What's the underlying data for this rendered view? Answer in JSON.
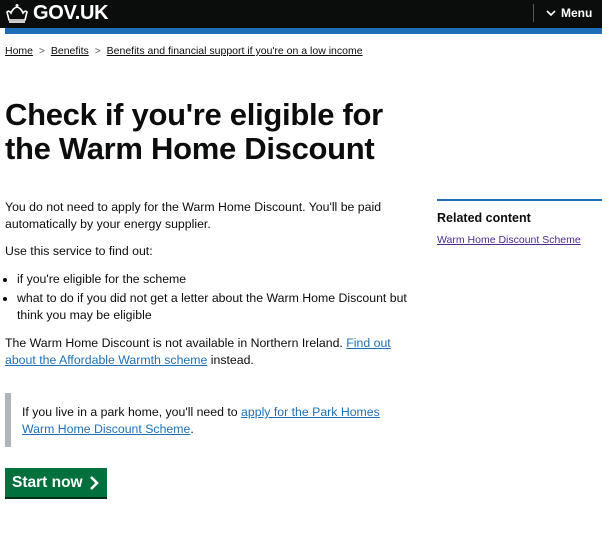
{
  "header": {
    "logo_text": "GOV.UK",
    "menu_label": "Menu"
  },
  "colors": {
    "header_bg": "#0b0c0c",
    "brand_blue": "#1d70b8",
    "start_button": "#00703c",
    "visited_link": "#4c2c92"
  },
  "breadcrumb": [
    {
      "label": "Home"
    },
    {
      "label": "Benefits"
    },
    {
      "label": "Benefits and financial support if you're on a low income"
    }
  ],
  "page_title": "Check if you're eligible for the Warm Home Discount",
  "intro": "You do not need to apply for the Warm Home Discount. You'll be paid automatically by your energy supplier.",
  "use_service": "Use this service to find out:",
  "bullets": [
    "if you're eligible for the scheme",
    "what to do if you did not get a letter about the Warm Home Discount but think you may be eligible"
  ],
  "ni_text": "The Warm Home Discount is not available in Northern Ireland.",
  "ni_link": "Find out about the Affordable Warmth scheme",
  "ni_suffix": "instead.",
  "inset": {
    "text": "If you live in a park home, you'll need to",
    "link": "apply for the Park Homes Warm Home Discount Scheme",
    "suffix": "."
  },
  "start_button": "Start now",
  "related": {
    "heading": "Related content",
    "links": [
      "Warm Home Discount Scheme"
    ]
  }
}
